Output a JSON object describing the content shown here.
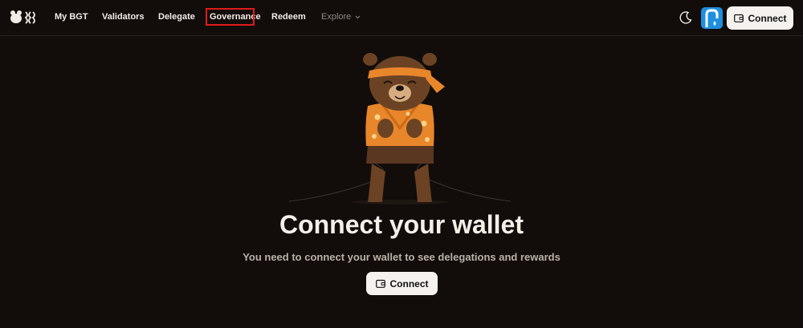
{
  "header": {
    "logo_icon": "bear-paw-logo-icon",
    "nav": [
      {
        "label": "My BGT"
      },
      {
        "label": "Validators"
      },
      {
        "label": "Delegate"
      },
      {
        "label": "Governance",
        "highlighted": true
      },
      {
        "label": "Redeem"
      },
      {
        "label": "Explore"
      }
    ],
    "theme_icon": "moon-icon",
    "connect_label": "Connect"
  },
  "main": {
    "title": "Connect your wallet",
    "subtitle": "You need to connect your wallet to see delegations and rewards",
    "connect_label": "Connect"
  },
  "colors": {
    "background": "#120d0a",
    "button_bg": "#f4f1ee",
    "highlight": "#e01b1b",
    "avatar": "#1f8fe0",
    "bear_fur": "#6b4324",
    "shirt": "#e8862a"
  }
}
